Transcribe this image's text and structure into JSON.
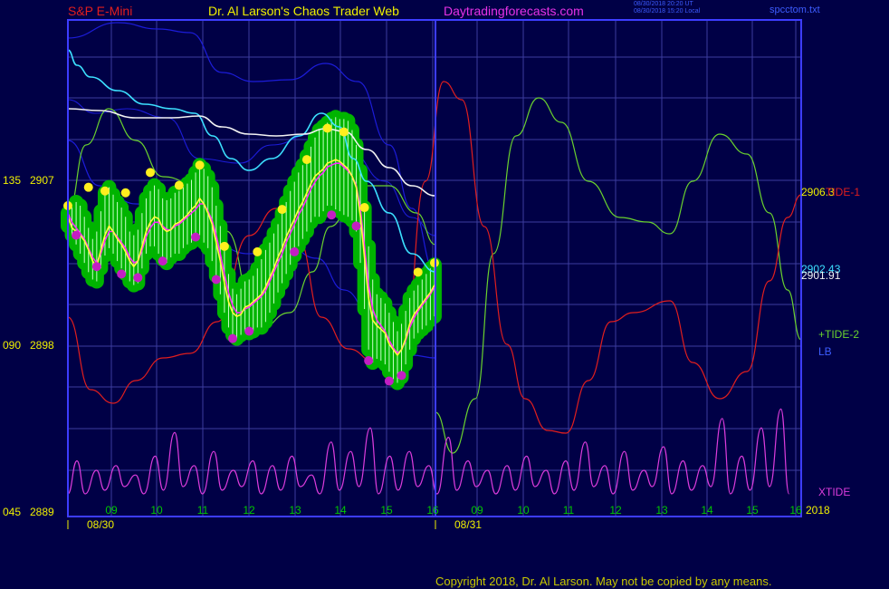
{
  "header": {
    "symbol": "S&P E-Mini",
    "title": "Dr. Al Larson's Chaos Trader Web",
    "site": "Daytradingforecasts.com",
    "stamp_line1": "08/30/2018 20:20 UT",
    "stamp_line2": "08/30/2018 15:20 Local",
    "filename": "spcctom.txt"
  },
  "colors": {
    "background": "#000046",
    "price_range": "#00b400",
    "price_line": "#ffff3c",
    "ema_short": "#ff28ff",
    "average_cyan": "#3ce0ff",
    "average_white": "#f2f2f2",
    "band": "#1c1cd8",
    "tide1": "#e11e1e",
    "tide2": "#6ad22e",
    "xtide": "#dc3cdc",
    "high_dot": "#ffef1e",
    "low_dot": "#c31ec3",
    "grid": "#3c3c9e"
  },
  "chart_data": {
    "type": "line",
    "title": "S&P E-Mini",
    "y_axis_labels": [
      {
        "code": "135",
        "price": "2907"
      },
      {
        "code": "090",
        "price": "2898"
      },
      {
        "code": "045",
        "price": "2889"
      }
    ],
    "ylim": [
      2889,
      2910.5
    ],
    "x_hour_labels": [
      "09",
      "10",
      "11",
      "12",
      "13",
      "14",
      "15",
      "16",
      "09",
      "10",
      "11",
      "12",
      "13",
      "14",
      "15",
      "16"
    ],
    "date_labels": [
      "08/30",
      "08/31"
    ],
    "year_label": "2018",
    "legend": {
      "tide1": "TIDE-1",
      "tide2": "+TIDE-2",
      "lb": "LB",
      "xtide": "XTIDE"
    },
    "end_values": {
      "tide1": "2906.3",
      "cyan": "2902.43",
      "white": "2901.91"
    },
    "price_bars": [
      [
        0,
        2904.5,
        2905.2
      ],
      [
        1,
        2904.0,
        2905.5
      ],
      [
        2,
        2903.5,
        2905.8
      ],
      [
        3,
        2903.0,
        2905.6
      ],
      [
        4,
        2902.5,
        2905.0
      ],
      [
        5,
        2902.0,
        2904.4
      ],
      [
        6,
        2901.6,
        2903.8
      ],
      [
        7,
        2901.5,
        2904.2
      ],
      [
        8,
        2902.2,
        2905.3
      ],
      [
        9,
        2902.9,
        2906.3
      ],
      [
        10,
        2903.3,
        2906.6
      ],
      [
        11,
        2903.0,
        2906.2
      ],
      [
        12,
        2902.6,
        2905.8
      ],
      [
        13,
        2902.2,
        2905.5
      ],
      [
        14,
        2901.9,
        2905.0
      ],
      [
        15,
        2901.5,
        2904.2
      ],
      [
        16,
        2901.3,
        2904.0
      ],
      [
        17,
        2901.4,
        2904.3
      ],
      [
        18,
        2902.2,
        2905.2
      ],
      [
        19,
        2903.0,
        2906.0
      ],
      [
        20,
        2903.4,
        2906.4
      ],
      [
        21,
        2903.4,
        2906.7
      ],
      [
        22,
        2903.0,
        2906.5
      ],
      [
        23,
        2902.7,
        2906.0
      ],
      [
        24,
        2902.5,
        2905.9
      ],
      [
        25,
        2902.8,
        2906.0
      ],
      [
        26,
        2903.0,
        2906.3
      ],
      [
        27,
        2903.0,
        2906.4
      ],
      [
        28,
        2903.3,
        2906.6
      ],
      [
        29,
        2903.5,
        2906.8
      ],
      [
        30,
        2903.6,
        2907.0
      ],
      [
        31,
        2903.8,
        2907.4
      ],
      [
        32,
        2904.0,
        2907.8
      ],
      [
        33,
        2903.6,
        2907.6
      ],
      [
        34,
        2903.3,
        2907.2
      ],
      [
        35,
        2902.6,
        2906.6
      ],
      [
        36,
        2901.8,
        2905.6
      ],
      [
        37,
        2900.8,
        2904.5
      ],
      [
        38,
        2899.8,
        2903.2
      ],
      [
        39,
        2899.0,
        2901.9
      ],
      [
        40,
        2898.6,
        2901.1
      ],
      [
        41,
        2898.4,
        2900.8
      ],
      [
        42,
        2898.6,
        2901.1
      ],
      [
        43,
        2898.8,
        2901.5
      ],
      [
        44,
        2898.7,
        2901.6
      ],
      [
        45,
        2898.8,
        2901.8
      ],
      [
        46,
        2899.0,
        2902.2
      ],
      [
        47,
        2899.0,
        2902.7
      ],
      [
        48,
        2899.3,
        2903.2
      ],
      [
        49,
        2899.8,
        2903.6
      ],
      [
        50,
        2900.3,
        2904.1
      ],
      [
        51,
        2900.9,
        2904.6
      ],
      [
        52,
        2901.4,
        2905.2
      ],
      [
        53,
        2901.9,
        2905.8
      ],
      [
        54,
        2902.4,
        2906.4
      ],
      [
        55,
        2902.9,
        2906.9
      ],
      [
        56,
        2903.4,
        2907.4
      ],
      [
        57,
        2903.8,
        2907.8
      ],
      [
        58,
        2904.2,
        2908.3
      ],
      [
        59,
        2904.7,
        2908.8
      ],
      [
        60,
        2905.0,
        2909.3
      ],
      [
        61,
        2905.0,
        2909.7
      ],
      [
        62,
        2905.3,
        2909.9
      ],
      [
        63,
        2905.6,
        2910.1
      ],
      [
        64,
        2905.6,
        2910.3
      ],
      [
        65,
        2905.4,
        2910.4
      ],
      [
        66,
        2905.3,
        2910.3
      ],
      [
        67,
        2905.1,
        2910.3
      ],
      [
        68,
        2905.0,
        2910.2
      ],
      [
        69,
        2904.8,
        2909.7
      ],
      [
        70,
        2904.2,
        2908.9
      ],
      [
        71,
        2902.5,
        2907.5
      ],
      [
        72,
        2900.0,
        2905.5
      ],
      [
        73,
        2897.8,
        2903.4
      ],
      [
        74,
        2897.1,
        2901.6
      ],
      [
        75,
        2897.3,
        2900.8
      ],
      [
        76,
        2897.2,
        2900.6
      ],
      [
        77,
        2897.0,
        2900.3
      ],
      [
        78,
        2896.6,
        2899.8
      ],
      [
        79,
        2896.2,
        2899.3
      ],
      [
        80,
        2896.0,
        2898.8
      ],
      [
        81,
        2896.3,
        2899.2
      ],
      [
        82,
        2897.0,
        2899.9
      ],
      [
        83,
        2897.8,
        2900.6
      ],
      [
        84,
        2898.4,
        2901.0
      ],
      [
        85,
        2898.7,
        2901.3
      ],
      [
        86,
        2898.9,
        2901.6
      ],
      [
        87,
        2899.1,
        2901.9
      ],
      [
        88,
        2899.4,
        2902.2
      ],
      [
        89,
        2899.6,
        2902.4
      ]
    ],
    "price_close": [
      2905.0,
      2904.4,
      2904.2,
      2904.0,
      2903.7,
      2903.2,
      2902.6,
      2902.3,
      2903.2,
      2904.0,
      2904.5,
      2904.2,
      2903.8,
      2903.5,
      2903.1,
      2902.6,
      2902.3,
      2902.6,
      2903.4,
      2904.2,
      2904.7,
      2905.0,
      2904.9,
      2904.4,
      2904.2,
      2904.3,
      2904.6,
      2904.7,
      2904.9,
      2905.1,
      2905.4,
      2905.6,
      2906.0,
      2905.7,
      2905.2,
      2904.6,
      2903.6,
      2902.6,
      2901.4,
      2900.4,
      2899.8,
      2899.6,
      2899.7,
      2900.1,
      2900.2,
      2900.4,
      2900.6,
      2900.8,
      2901.2,
      2901.7,
      2902.2,
      2902.8,
      2903.3,
      2903.9,
      2904.4,
      2904.9,
      2905.4,
      2905.8,
      2906.3,
      2906.8,
      2907.2,
      2907.4,
      2907.6,
      2907.9,
      2908.0,
      2908.1,
      2908.0,
      2907.8,
      2907.6,
      2907.2,
      2906.6,
      2905.0,
      2902.8,
      2900.6,
      2899.4,
      2899.1,
      2898.9,
      2898.7,
      2898.1,
      2897.8,
      2897.5,
      2897.8,
      2898.4,
      2899.2,
      2899.7,
      2900.0,
      2900.3,
      2900.6,
      2900.9,
      2901.3
    ],
    "ema_short": [
      2905.2,
      2904.7,
      2904.4,
      2904.1,
      2903.8,
      2903.3,
      2902.8,
      2902.5,
      2903.0,
      2903.7,
      2904.2,
      2904.2,
      2903.9,
      2903.6,
      2903.3,
      2902.8,
      2902.5,
      2902.6,
      2903.2,
      2903.9,
      2904.4,
      2904.7,
      2904.7,
      2904.5,
      2904.3,
      2904.3,
      2904.5,
      2904.6,
      2904.8,
      2905.0,
      2905.2,
      2905.4,
      2905.7,
      2905.7,
      2905.3,
      2904.8,
      2904.0,
      2903.0,
      2901.9,
      2900.9,
      2900.2,
      2899.8,
      2899.8,
      2900.0,
      2900.1,
      2900.3,
      2900.5,
      2900.7,
      2901.0,
      2901.5,
      2902.0,
      2902.5,
      2903.0,
      2903.6,
      2904.1,
      2904.6,
      2905.1,
      2905.5,
      2906.0,
      2906.5,
      2906.9,
      2907.2,
      2907.4,
      2907.7,
      2907.8,
      2907.9,
      2907.9,
      2907.7,
      2907.5,
      2907.2,
      2906.7,
      2905.4,
      2903.4,
      2901.3,
      2900.0,
      2899.4,
      2899.1,
      2898.8,
      2898.3,
      2897.9,
      2897.6,
      2897.8,
      2898.3,
      2899.0,
      2899.5,
      2899.9,
      2900.2,
      2900.5,
      2900.8,
      2901.2
    ],
    "highs_marked": [
      [
        0,
        2905.6
      ],
      [
        5,
        2906.6
      ],
      [
        9,
        2906.4
      ],
      [
        14,
        2906.3
      ],
      [
        20,
        2907.4
      ],
      [
        27,
        2906.7
      ],
      [
        32,
        2907.8
      ],
      [
        38,
        2903.4
      ],
      [
        46,
        2903.1
      ],
      [
        52,
        2905.4
      ],
      [
        58,
        2908.1
      ],
      [
        63,
        2909.8
      ],
      [
        67,
        2909.6
      ],
      [
        72,
        2905.5
      ],
      [
        85,
        2902.0
      ],
      [
        89,
        2902.5
      ]
    ],
    "lows_marked": [
      [
        2,
        2904.0
      ],
      [
        7,
        2902.3
      ],
      [
        13,
        2901.9
      ],
      [
        17,
        2901.7
      ],
      [
        23,
        2902.6
      ],
      [
        31,
        2903.9
      ],
      [
        36,
        2901.6
      ],
      [
        40,
        2898.4
      ],
      [
        44,
        2898.8
      ],
      [
        55,
        2903.1
      ],
      [
        64,
        2905.1
      ],
      [
        70,
        2904.5
      ],
      [
        73,
        2897.2
      ],
      [
        78,
        2896.1
      ],
      [
        81,
        2896.4
      ]
    ]
  }
}
